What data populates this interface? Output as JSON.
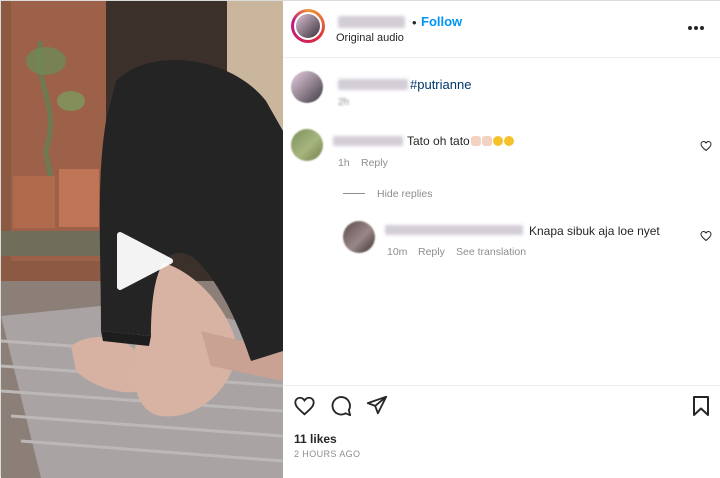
{
  "header": {
    "follow_label": "Follow",
    "audio_label": "Original audio",
    "more_icon": "ellipsis-icon"
  },
  "caption": {
    "hashtag": "#putrianne",
    "time": "2h"
  },
  "comments": [
    {
      "text": "Tato oh tato",
      "emoji": [
        "waving-hands",
        "waving-hands",
        "laughing-face",
        "laughing-face"
      ],
      "time": "1h",
      "reply_label": "Reply"
    }
  ],
  "hide_replies_label": "Hide replies",
  "replies": [
    {
      "text": "Knapa sibuk aja loe nyet",
      "time": "10m",
      "reply_label": "Reply",
      "translation_label": "See translation"
    }
  ],
  "actions": {
    "icons": [
      "heart-icon",
      "comment-icon",
      "share-icon",
      "bookmark-icon"
    ]
  },
  "likes_label": "11 likes",
  "posted_ago": "2 HOURS AGO",
  "colors": {
    "accent": "#0095f6",
    "hashtag": "#00376b",
    "muted": "#8e8e8e"
  }
}
